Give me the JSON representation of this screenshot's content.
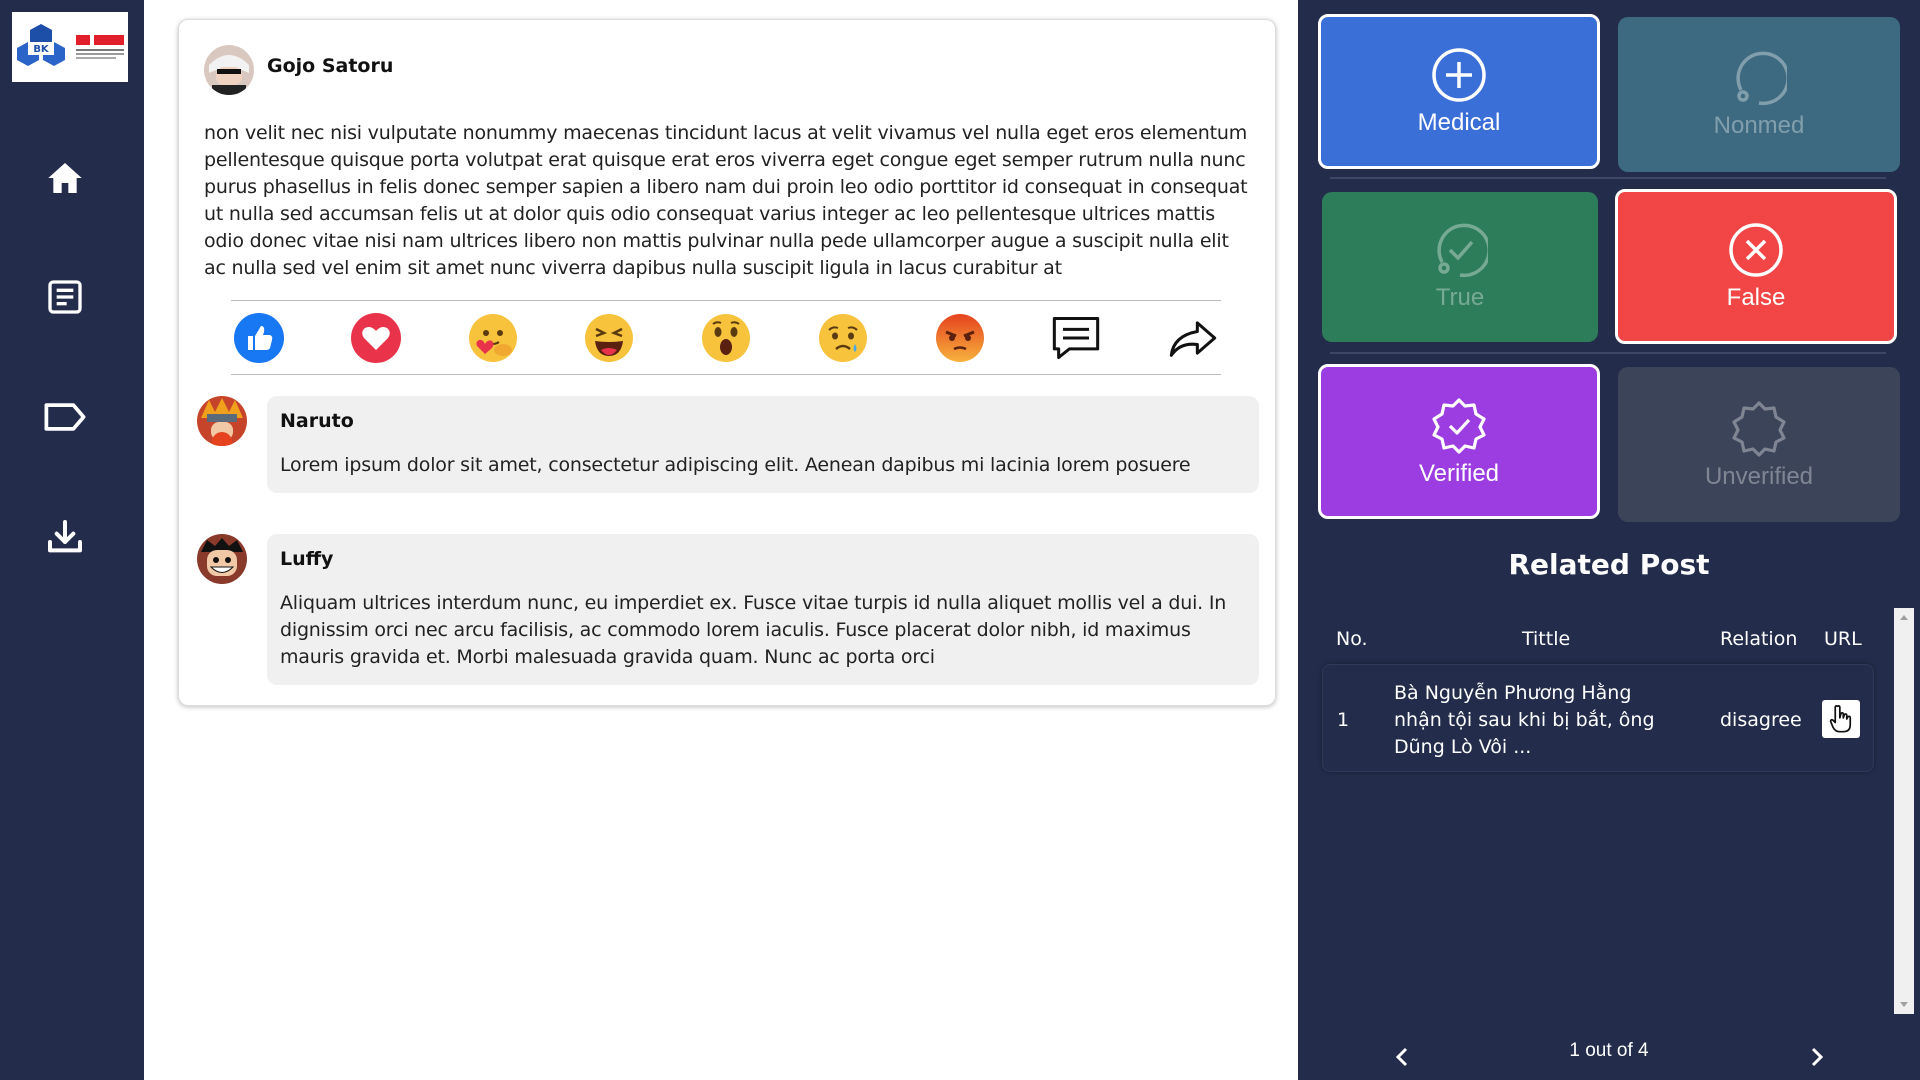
{
  "post": {
    "author": "Gojo Satoru",
    "text": "non velit nec nisi vulputate nonummy maecenas tincidunt lacus at velit vivamus vel nulla eget eros elementum pellentesque quisque porta volutpat erat quisque erat eros viverra eget congue eget semper rutrum nulla nunc purus phasellus in felis donec semper sapien a libero nam dui proin leo odio porttitor id consequat in consequat ut nulla sed accumsan felis ut at dolor quis odio consequat varius integer ac leo pellentesque ultrices mattis odio donec vitae nisi nam ultrices libero non mattis pulvinar nulla pede ullamcorper augue a suscipit nulla elit ac nulla sed vel enim sit amet nunc viverra dapibus nulla suscipit ligula in lacus curabitur at"
  },
  "reactions": [
    "like-icon",
    "love-icon",
    "care-icon",
    "haha-icon",
    "wow-icon",
    "sad-icon",
    "angry-icon",
    "comment-icon",
    "share-icon"
  ],
  "comments": [
    {
      "name": "Naruto",
      "text": "Lorem ipsum dolor sit amet, consectetur adipiscing elit. Aenean dapibus mi lacinia lorem posuere"
    },
    {
      "name": "Luffy",
      "text": "Aliquam ultrices interdum nunc, eu imperdiet ex. Fusce vitae turpis id nulla aliquet mollis vel a dui. In dignissim orci nec arcu facilisis, ac commodo lorem iaculis. Fusce placerat dolor nibh, id maximus mauris gravida et. Morbi malesuada gravida quam. Nunc ac porta orci"
    }
  ],
  "classify": {
    "medical": "Medical",
    "nonmed": "Nonmed",
    "true": "True",
    "false": "False",
    "verified": "Verified",
    "unverified": "Unverified"
  },
  "colors": {
    "medical": "#3a6fd8",
    "nonmed": "#3d6a80",
    "true": "#2e7d5a",
    "false": "#f24545",
    "verified": "#9b3de0",
    "unverified": "#3b4459",
    "sidebar": "#232d4b"
  },
  "related": {
    "title": "Related Post",
    "columns": {
      "no": "No.",
      "title": "Tittle",
      "relation": "Relation",
      "url": "URL"
    },
    "rows": [
      {
        "no": "1",
        "title": "Bà Nguyễn Phương Hằng nhận tội sau khi bị bắt, ông Dũng Lò Vôi ...",
        "relation": "disagree"
      }
    ],
    "pager": "1 out of 4"
  },
  "nav": [
    "home-icon",
    "document-icon",
    "tag-icon",
    "download-icon"
  ]
}
